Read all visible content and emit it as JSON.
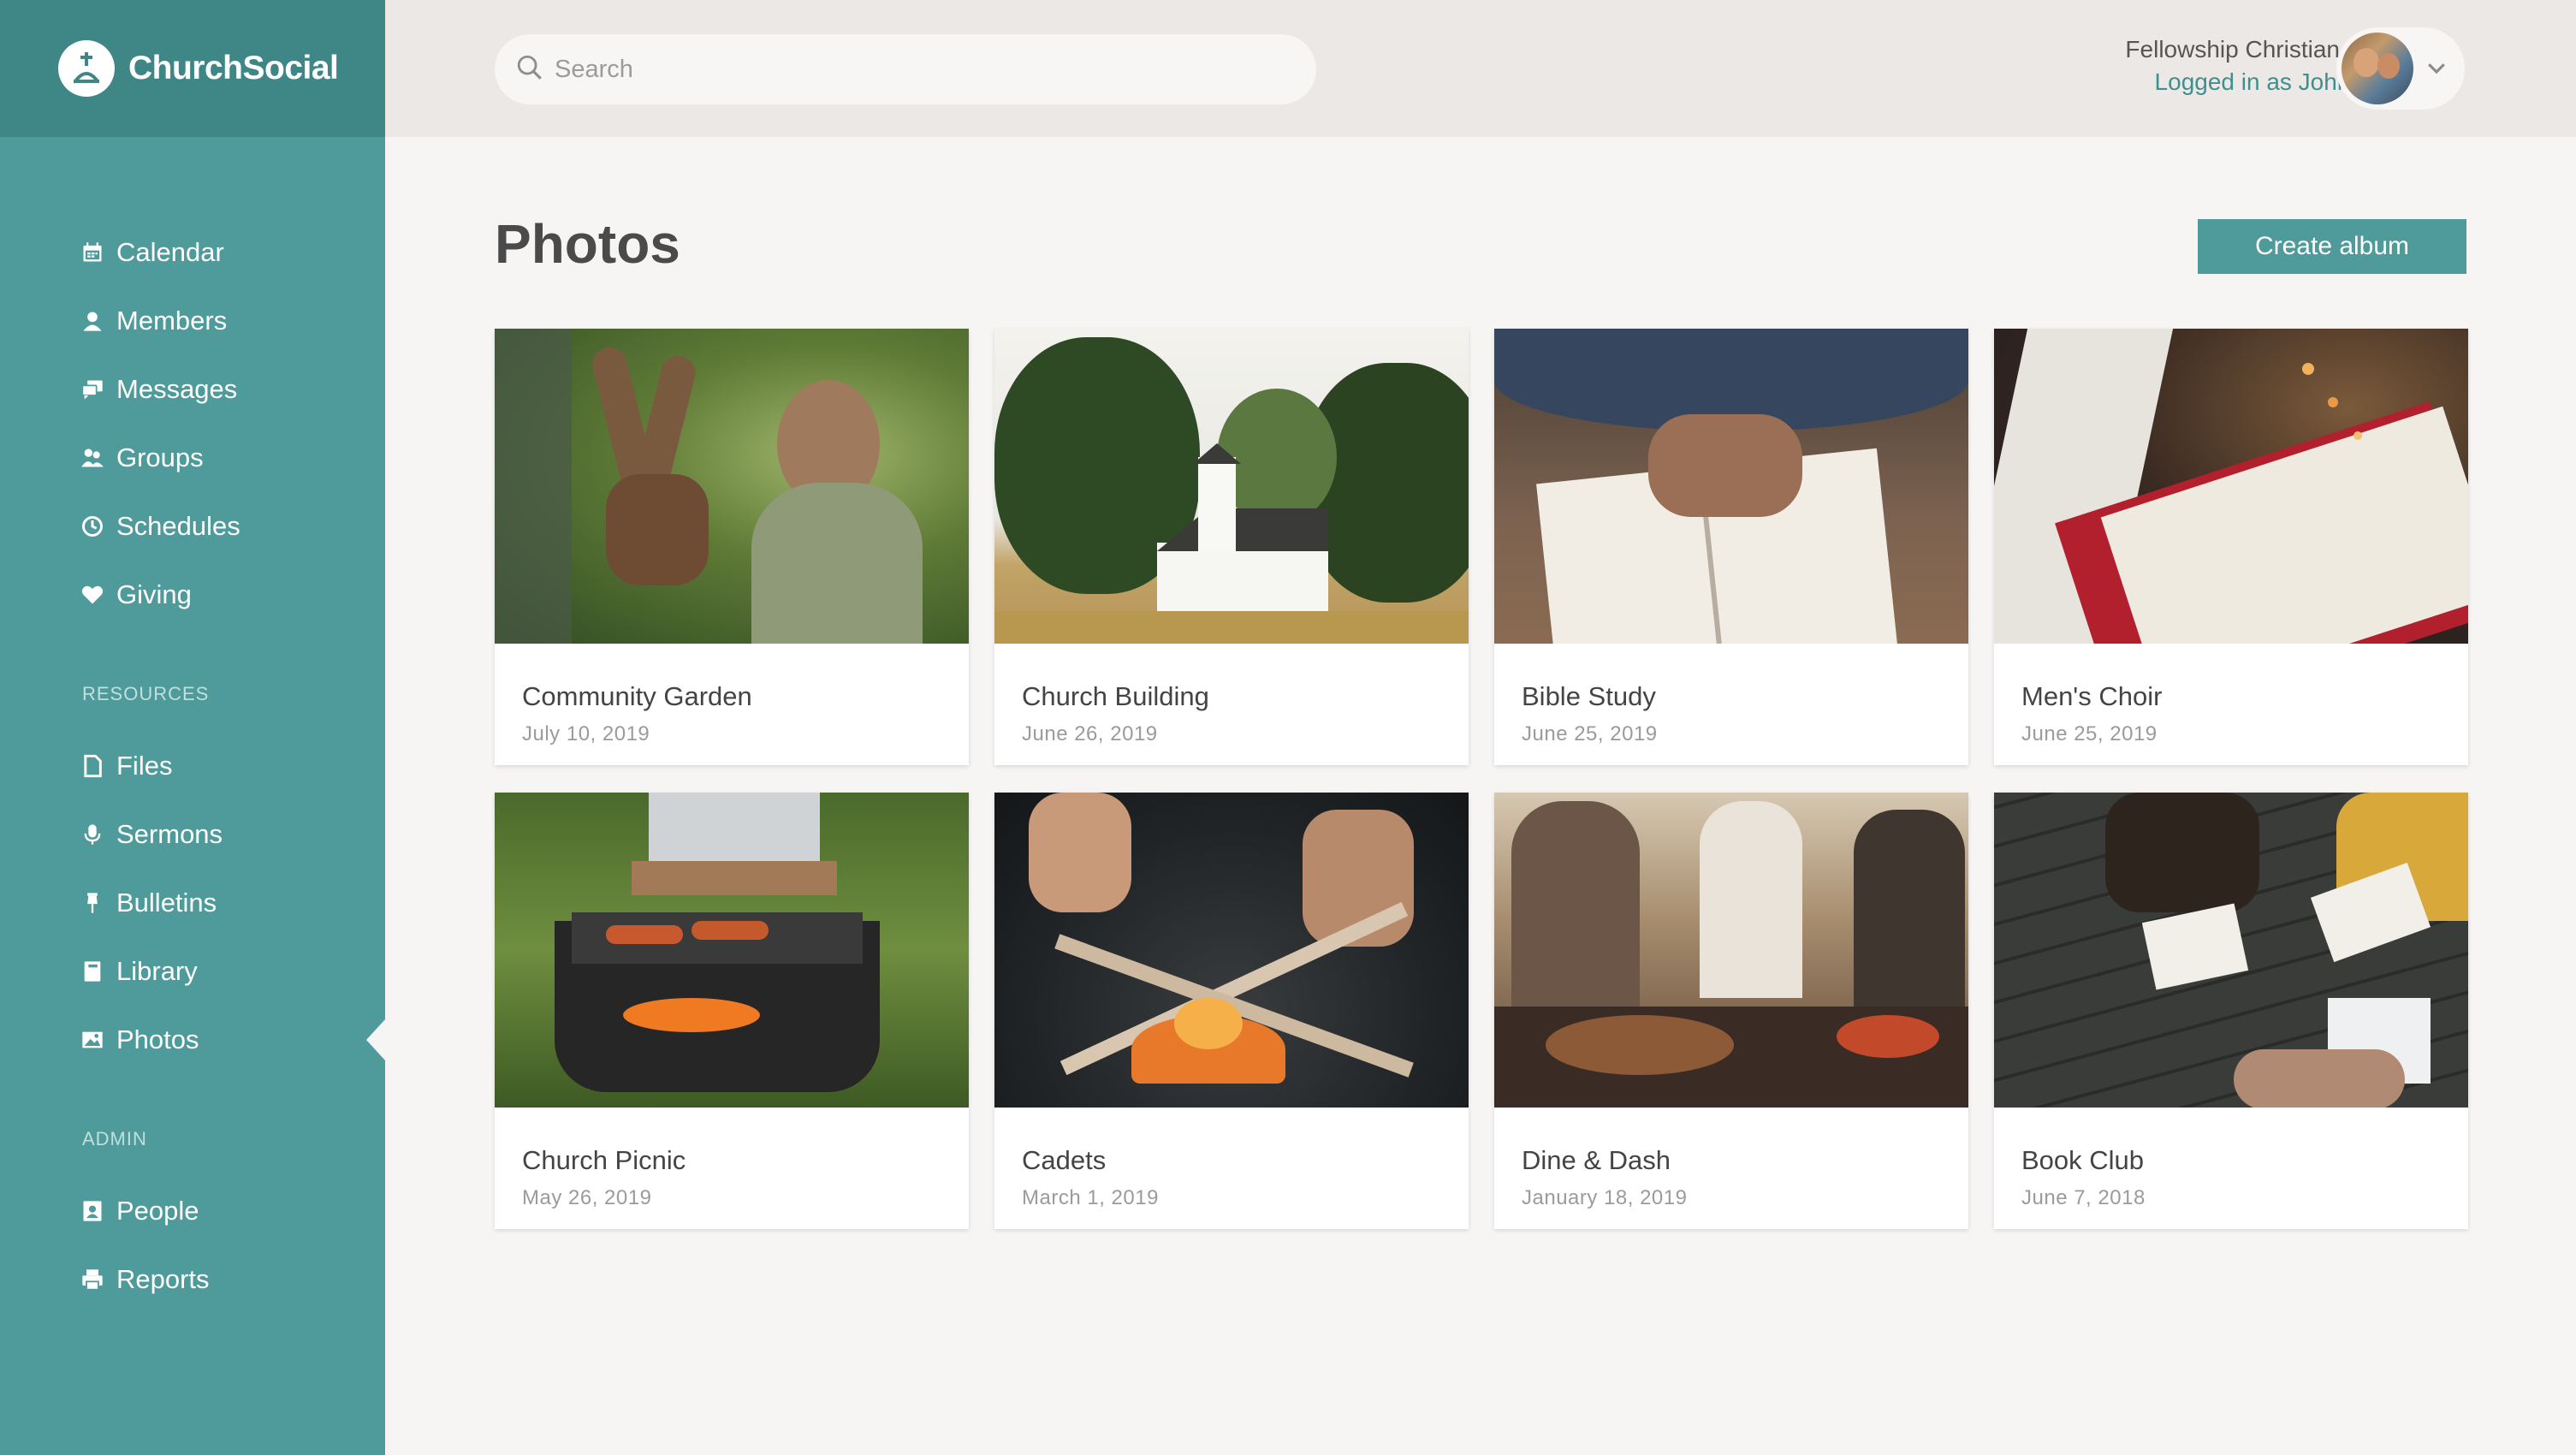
{
  "brand": {
    "name": "ChurchSocial"
  },
  "sidebar": {
    "items": [
      {
        "label": "Calendar",
        "icon": "calendar-icon"
      },
      {
        "label": "Members",
        "icon": "user-icon"
      },
      {
        "label": "Messages",
        "icon": "chat-icon"
      },
      {
        "label": "Groups",
        "icon": "groups-icon"
      },
      {
        "label": "Schedules",
        "icon": "clock-icon"
      },
      {
        "label": "Giving",
        "icon": "heart-icon"
      }
    ],
    "resources_heading": "RESOURCES",
    "resources": [
      {
        "label": "Files",
        "icon": "file-icon"
      },
      {
        "label": "Sermons",
        "icon": "microphone-icon"
      },
      {
        "label": "Bulletins",
        "icon": "pin-icon"
      },
      {
        "label": "Library",
        "icon": "book-icon"
      },
      {
        "label": "Photos",
        "icon": "image-icon",
        "active": true
      }
    ],
    "admin_heading": "ADMIN",
    "admin": [
      {
        "label": "People",
        "icon": "contact-icon"
      },
      {
        "label": "Reports",
        "icon": "printer-icon"
      }
    ]
  },
  "header": {
    "search_placeholder": "Search",
    "org_name": "Fellowship Christian Church",
    "logged_in": "Logged in as John Calvin"
  },
  "main": {
    "title": "Photos",
    "create_label": "Create album",
    "albums": [
      {
        "title": "Community Garden",
        "date": "July 10, 2019"
      },
      {
        "title": "Church Building",
        "date": "June 26, 2019"
      },
      {
        "title": "Bible Study",
        "date": "June 25, 2019"
      },
      {
        "title": "Men's Choir",
        "date": "June 25, 2019"
      },
      {
        "title": "Church Picnic",
        "date": "May 26, 2019"
      },
      {
        "title": "Cadets",
        "date": "March 1, 2019"
      },
      {
        "title": "Dine & Dash",
        "date": "January 18, 2019"
      },
      {
        "title": "Book Club",
        "date": "June 7, 2018"
      }
    ]
  },
  "colors": {
    "sidebar": "#4f9a9b",
    "brand_bar": "#3f8787",
    "accent": "#3f8f8f",
    "background": "#f6f5f4"
  }
}
